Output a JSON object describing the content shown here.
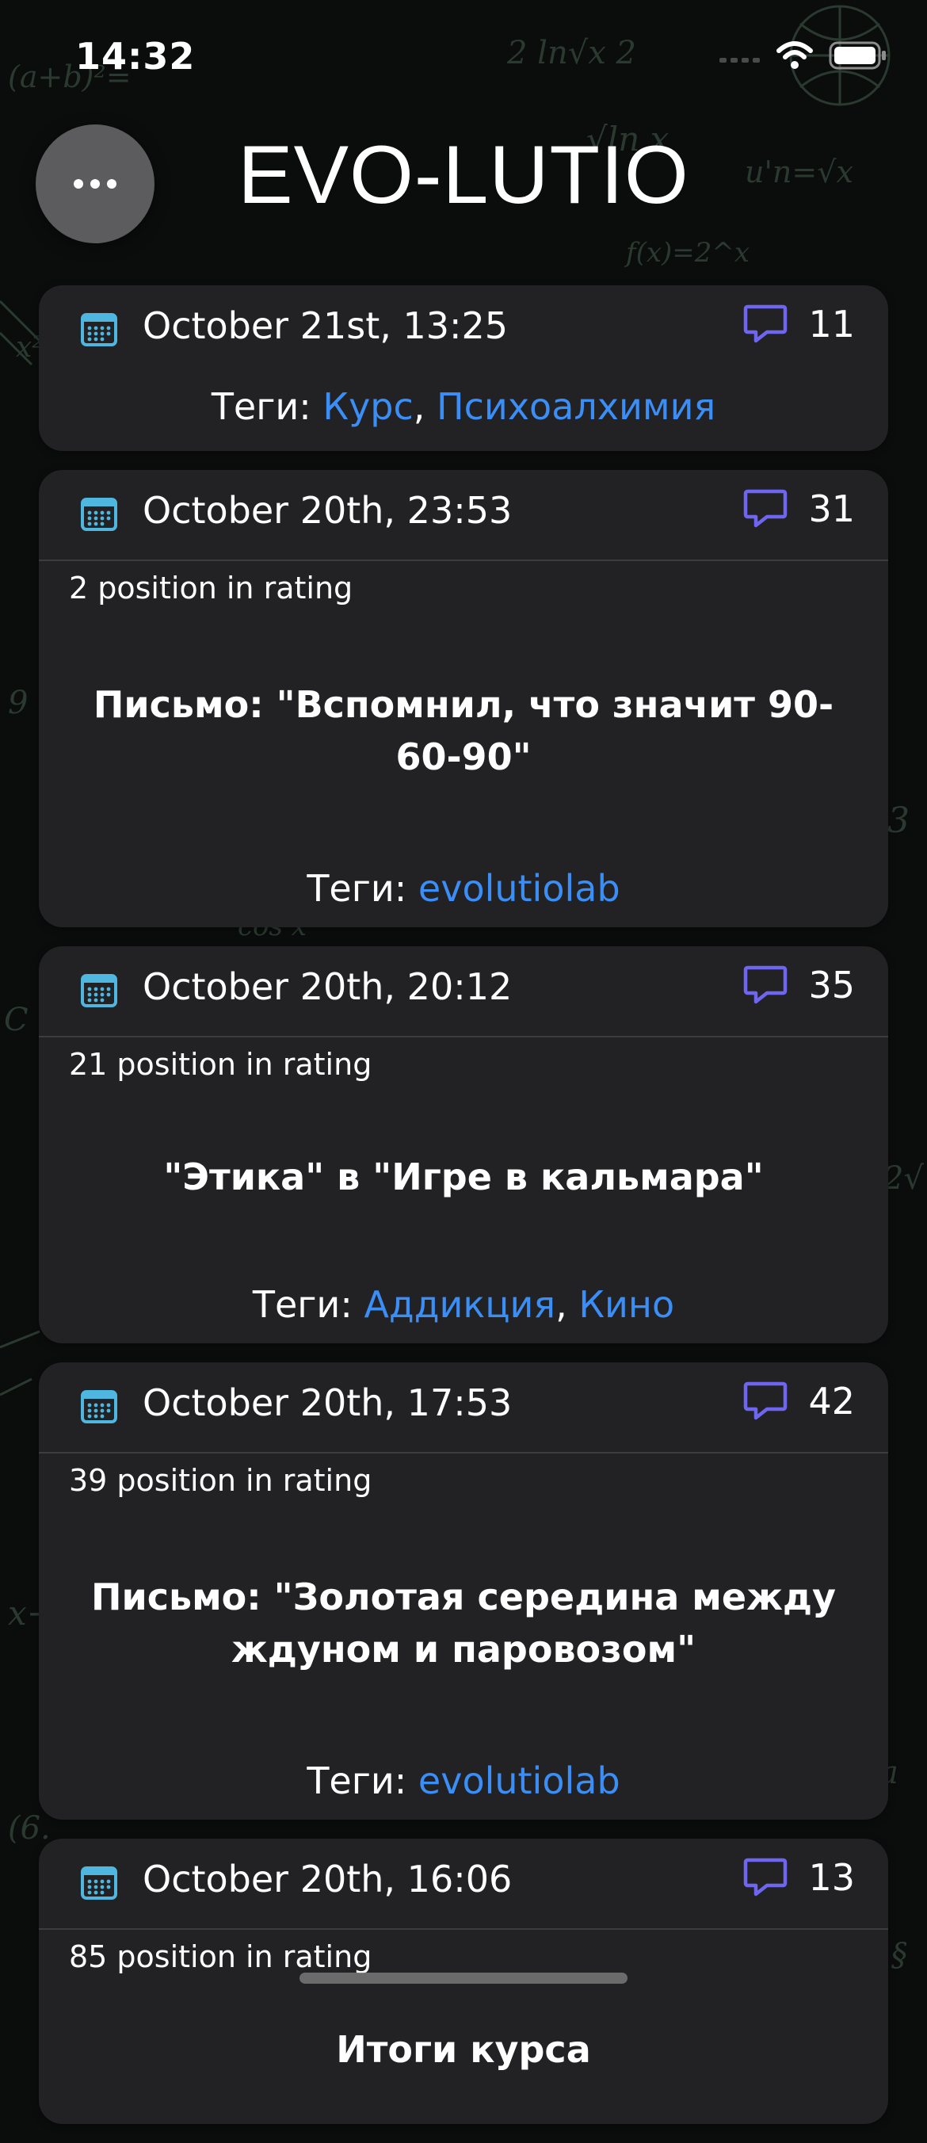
{
  "status_bar": {
    "time": "14:32"
  },
  "header": {
    "title": "EVO-LUTIO"
  },
  "labels": {
    "tags_prefix": "Теги: "
  },
  "posts": [
    {
      "date": "October 21st, 13:25",
      "comments": "11",
      "rating": "",
      "title": "",
      "tags": [
        "Курс",
        "Психоалхимия"
      ]
    },
    {
      "date": "October 20th, 23:53",
      "comments": "31",
      "rating": "2 position in rating",
      "title": "Письмо: \"Вспомнил, что значит 90-60-90\"",
      "tags": [
        "evolutiolab"
      ]
    },
    {
      "date": "October 20th, 20:12",
      "comments": "35",
      "rating": "21 position in rating",
      "title": "\"Этика\" в \"Игре в кальмара\"",
      "tags": [
        "Аддикция",
        "Кино"
      ]
    },
    {
      "date": "October 20th, 17:53",
      "comments": "42",
      "rating": "39 position in rating",
      "title": "Письмо: \"Золотая середина между ждуном и паровозом\"",
      "tags": [
        "evolutiolab"
      ]
    },
    {
      "date": "October 20th, 16:06",
      "comments": "13",
      "rating": "85 position in rating",
      "title": "Итоги курса",
      "tags": []
    }
  ],
  "icons": {
    "calendar": "calendar-icon",
    "comment": "speech-bubble-icon",
    "menu": "ellipsis-icon",
    "wifi": "wifi-icon",
    "battery": "battery-icon"
  },
  "colors": {
    "calendar_icon": "#4fb6e0",
    "comment_icon": "#6e66f0",
    "tag_link": "#3a8ef5",
    "card_bg": "#222224"
  }
}
